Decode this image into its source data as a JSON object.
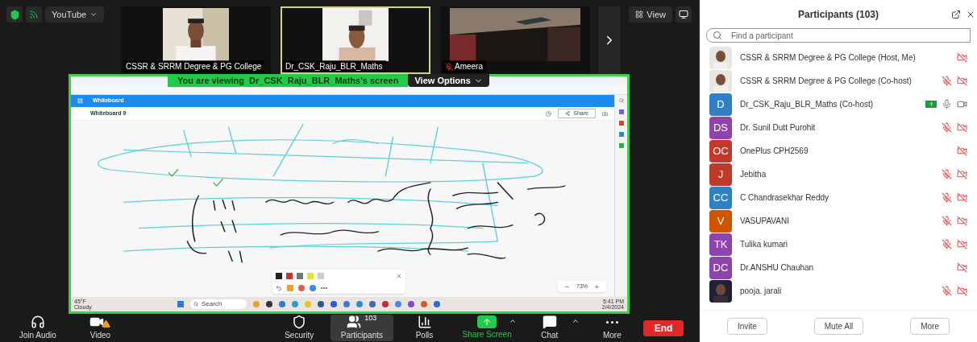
{
  "top_bar": {
    "app_menu": "YouTube",
    "view_button": "View"
  },
  "video_tiles": [
    {
      "name": "CSSR & SRRM Degree & PG College",
      "muted": false,
      "selected": false
    },
    {
      "name": "Dr_CSK_Raju_BLR_Maths",
      "muted": false,
      "selected": true
    },
    {
      "name": "Ameera",
      "muted": true,
      "selected": false
    }
  ],
  "share_banner": {
    "text": "You are viewing  Dr_CSK_Raju_BLR_Maths's screen",
    "options": "View Options"
  },
  "shared_screen": {
    "app_title": "Whiteboard",
    "board_title": "Whiteboard 9",
    "share_button": "Share",
    "zoom": "73%",
    "taskbar_search": "Search",
    "weather_temp": "45°F",
    "weather_text": "Cloudy",
    "time": "5:41 PM",
    "date": "2/4/2024"
  },
  "toolbar": [
    {
      "kind": "audio",
      "label": "Join Audio",
      "selected": false
    },
    {
      "kind": "video",
      "label": "Video",
      "selected": false
    },
    {
      "kind": "security",
      "label": "Security",
      "selected": false
    },
    {
      "kind": "participants",
      "label": "Participants",
      "badge": "103",
      "selected": true
    },
    {
      "kind": "polls",
      "label": "Polls",
      "selected": false
    },
    {
      "kind": "share",
      "label": "Share Screen",
      "selected": false
    },
    {
      "kind": "chat",
      "label": "Chat",
      "selected": false
    },
    {
      "kind": "more",
      "label": "More",
      "selected": false
    }
  ],
  "end_button": "End",
  "participants_panel": {
    "title": "Participants (103)",
    "search_placeholder": "Find a participant",
    "participants": [
      {
        "name": "CSSR & SRRM Degree & PG College (Host, Me)",
        "video_on": false
      },
      {
        "name": "CSSR & SRRM Degree & PG College (Co-host)",
        "audio_muted": true,
        "video_on": false
      },
      {
        "name": "Dr_CSK_Raju_BLR_Maths (Co-host)",
        "kind": "initials",
        "initials": "D",
        "color": "#2f80c4",
        "sharing": true,
        "audio_muted": false,
        "video_on": true
      },
      {
        "name": "Dr. Sunil Dutt Purohit",
        "kind": "initials",
        "initials": "DS",
        "color": "#8e44ad",
        "audio_muted": true,
        "video_on": false
      },
      {
        "name": "OnePlus CPH2569",
        "kind": "initials",
        "initials": "OC",
        "color": "#c0392b",
        "video_on": false
      },
      {
        "name": "Jebitha",
        "kind": "initials",
        "initials": "J",
        "color": "#c0392b",
        "audio_muted": true,
        "video_on": false
      },
      {
        "name": "C Chandrasekhar Reddy",
        "kind": "initials",
        "initials": "CC",
        "color": "#2f80c4",
        "audio_muted": true,
        "video_on": false
      },
      {
        "name": "VASUPAVANI",
        "kind": "initials",
        "initials": "V",
        "color": "#d35400",
        "audio_muted": true,
        "video_on": false
      },
      {
        "name": "Tulika kumari",
        "kind": "initials",
        "initials": "TK",
        "color": "#8e44ad",
        "audio_muted": true,
        "video_on": false
      },
      {
        "name": "Dr.ANSHU Chauhan",
        "kind": "initials",
        "initials": "DC",
        "color": "#8e44ad",
        "video_on": false
      },
      {
        "name": "pooja. jarali",
        "audio_muted": true,
        "video_on": false
      }
    ],
    "buttons": [
      "Invite",
      "Mute All",
      "More"
    ]
  }
}
